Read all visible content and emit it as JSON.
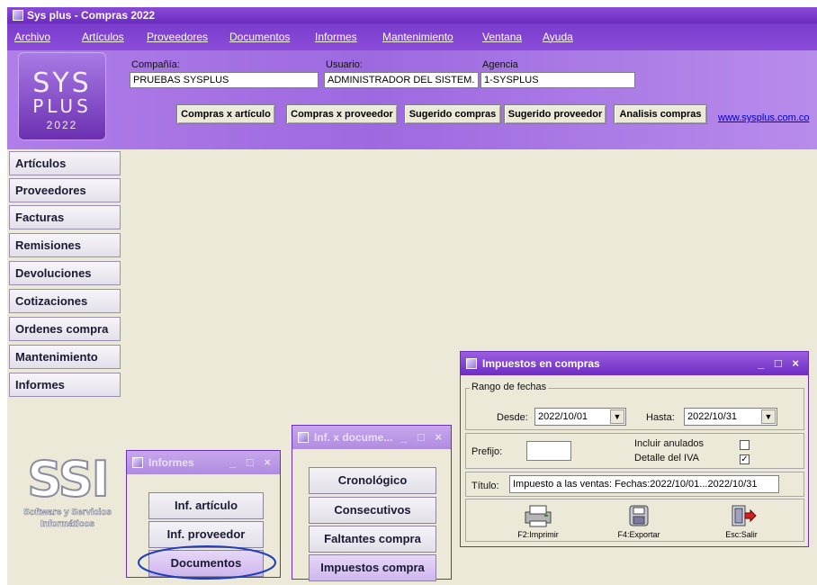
{
  "window": {
    "title": "Sys plus - Compras 2022"
  },
  "menu": [
    "Archivo",
    "Artículos",
    "Proveedores",
    "Documentos",
    "Informes",
    "Mantenimiento",
    "Ventana",
    "Ayuda"
  ],
  "logo": {
    "line1": "SYS",
    "line2": "PLUS",
    "year": "2022"
  },
  "fields": {
    "compania_label": "Compañía:",
    "compania_value": "PRUEBAS SYSPLUS",
    "usuario_label": "Usuario:",
    "usuario_value": "ADMINISTRADOR DEL SISTEM.",
    "agencia_label": "Agencia",
    "agencia_value": "1-SYSPLUS"
  },
  "quick_buttons": [
    "Compras x artículo",
    "Compras x proveedor",
    "Sugerido compras",
    "Sugerido proveedor",
    "Analisis compras"
  ],
  "web_link": "www.sysplus.com.co",
  "nav": [
    "Artículos",
    "Proveedores",
    "Facturas",
    "Remisiones",
    "Devoluciones",
    "Cotizaciones",
    "Ordenes compra",
    "Mantenimiento",
    "Informes"
  ],
  "ssi": {
    "logo": "SSI",
    "line1": "Software y Servicios",
    "line2": "Informáticos"
  },
  "informes_window": {
    "title": "Informes",
    "buttons": [
      "Inf. artículo",
      "Inf. proveedor",
      "Documentos"
    ]
  },
  "docs_window": {
    "title": "Inf. x docume...",
    "buttons": [
      "Cronológico",
      "Consecutivos",
      "Faltantes compra",
      "Impuestos compra"
    ]
  },
  "impuestos_window": {
    "title": "Impuestos en compras",
    "group_label": "Rango de fechas",
    "desde_label": "Desde:",
    "desde_value": "2022/10/01",
    "hasta_label": "Hasta:",
    "hasta_value": "2022/10/31",
    "prefijo_label": "Prefijo:",
    "prefijo_value": "",
    "incluir_label": "Incluir anulados",
    "incluir_checked": false,
    "detalle_label": "Detalle del IVA",
    "detalle_checked": true,
    "titulo_label": "Título:",
    "titulo_value": "Impuesto a las ventas: Fechas:2022/10/01...2022/10/31",
    "actions": [
      "F2:Imprimir",
      "F4:Exportar",
      "Esc:Salir"
    ]
  },
  "colors": {
    "accent": "#7a3ccc",
    "highlight_ellipse": "#1f3fbf",
    "link": "#0000cc"
  }
}
